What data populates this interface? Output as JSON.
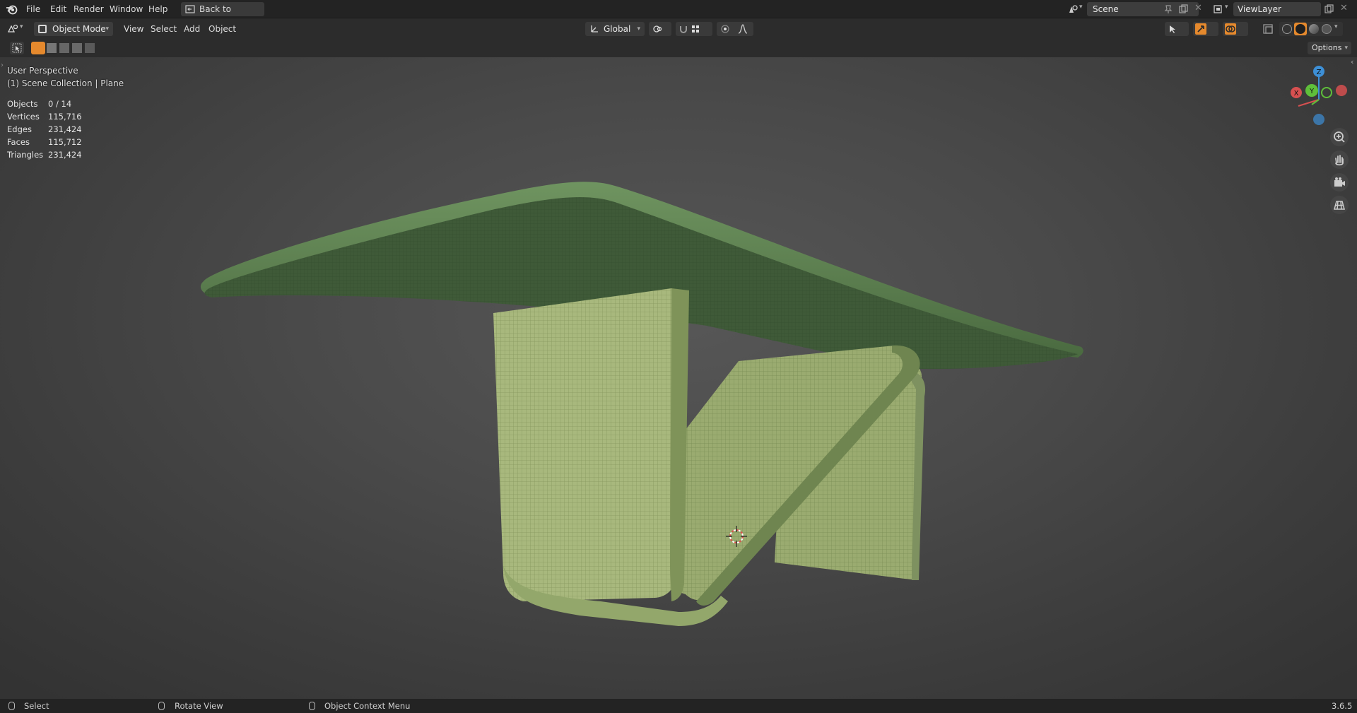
{
  "menu": {
    "items": [
      "File",
      "Edit",
      "Render",
      "Window",
      "Help"
    ],
    "back_label": "Back to Previous"
  },
  "scene": {
    "name": "Scene"
  },
  "view_layer": {
    "name": "ViewLayer"
  },
  "header": {
    "mode": "Object Mode",
    "menus": [
      "View",
      "Select",
      "Add",
      "Object"
    ],
    "transform_orientation": "Global"
  },
  "toolrow": {
    "options_label": "Options"
  },
  "viewport": {
    "perspective": "User Perspective",
    "collection": "(1) Scene Collection | Plane",
    "stats": [
      {
        "label": "Objects",
        "value": "0 / 14"
      },
      {
        "label": "Vertices",
        "value": "115,716"
      },
      {
        "label": "Edges",
        "value": "231,424"
      },
      {
        "label": "Faces",
        "value": "115,712"
      },
      {
        "label": "Triangles",
        "value": "231,424"
      }
    ],
    "gizmo": {
      "x": "X",
      "y": "Y",
      "z": "Z"
    }
  },
  "statusbar": {
    "select": "Select",
    "rotate": "Rotate View",
    "context": "Object Context Menu",
    "version": "3.6.5"
  },
  "colors": {
    "accent": "#e5892d",
    "gizmo_x": "#d65050",
    "gizmo_y": "#5fbf3a",
    "gizmo_z": "#3d8fd6",
    "plate_green": "#4c6a44",
    "body_green": "#a7b77c"
  }
}
